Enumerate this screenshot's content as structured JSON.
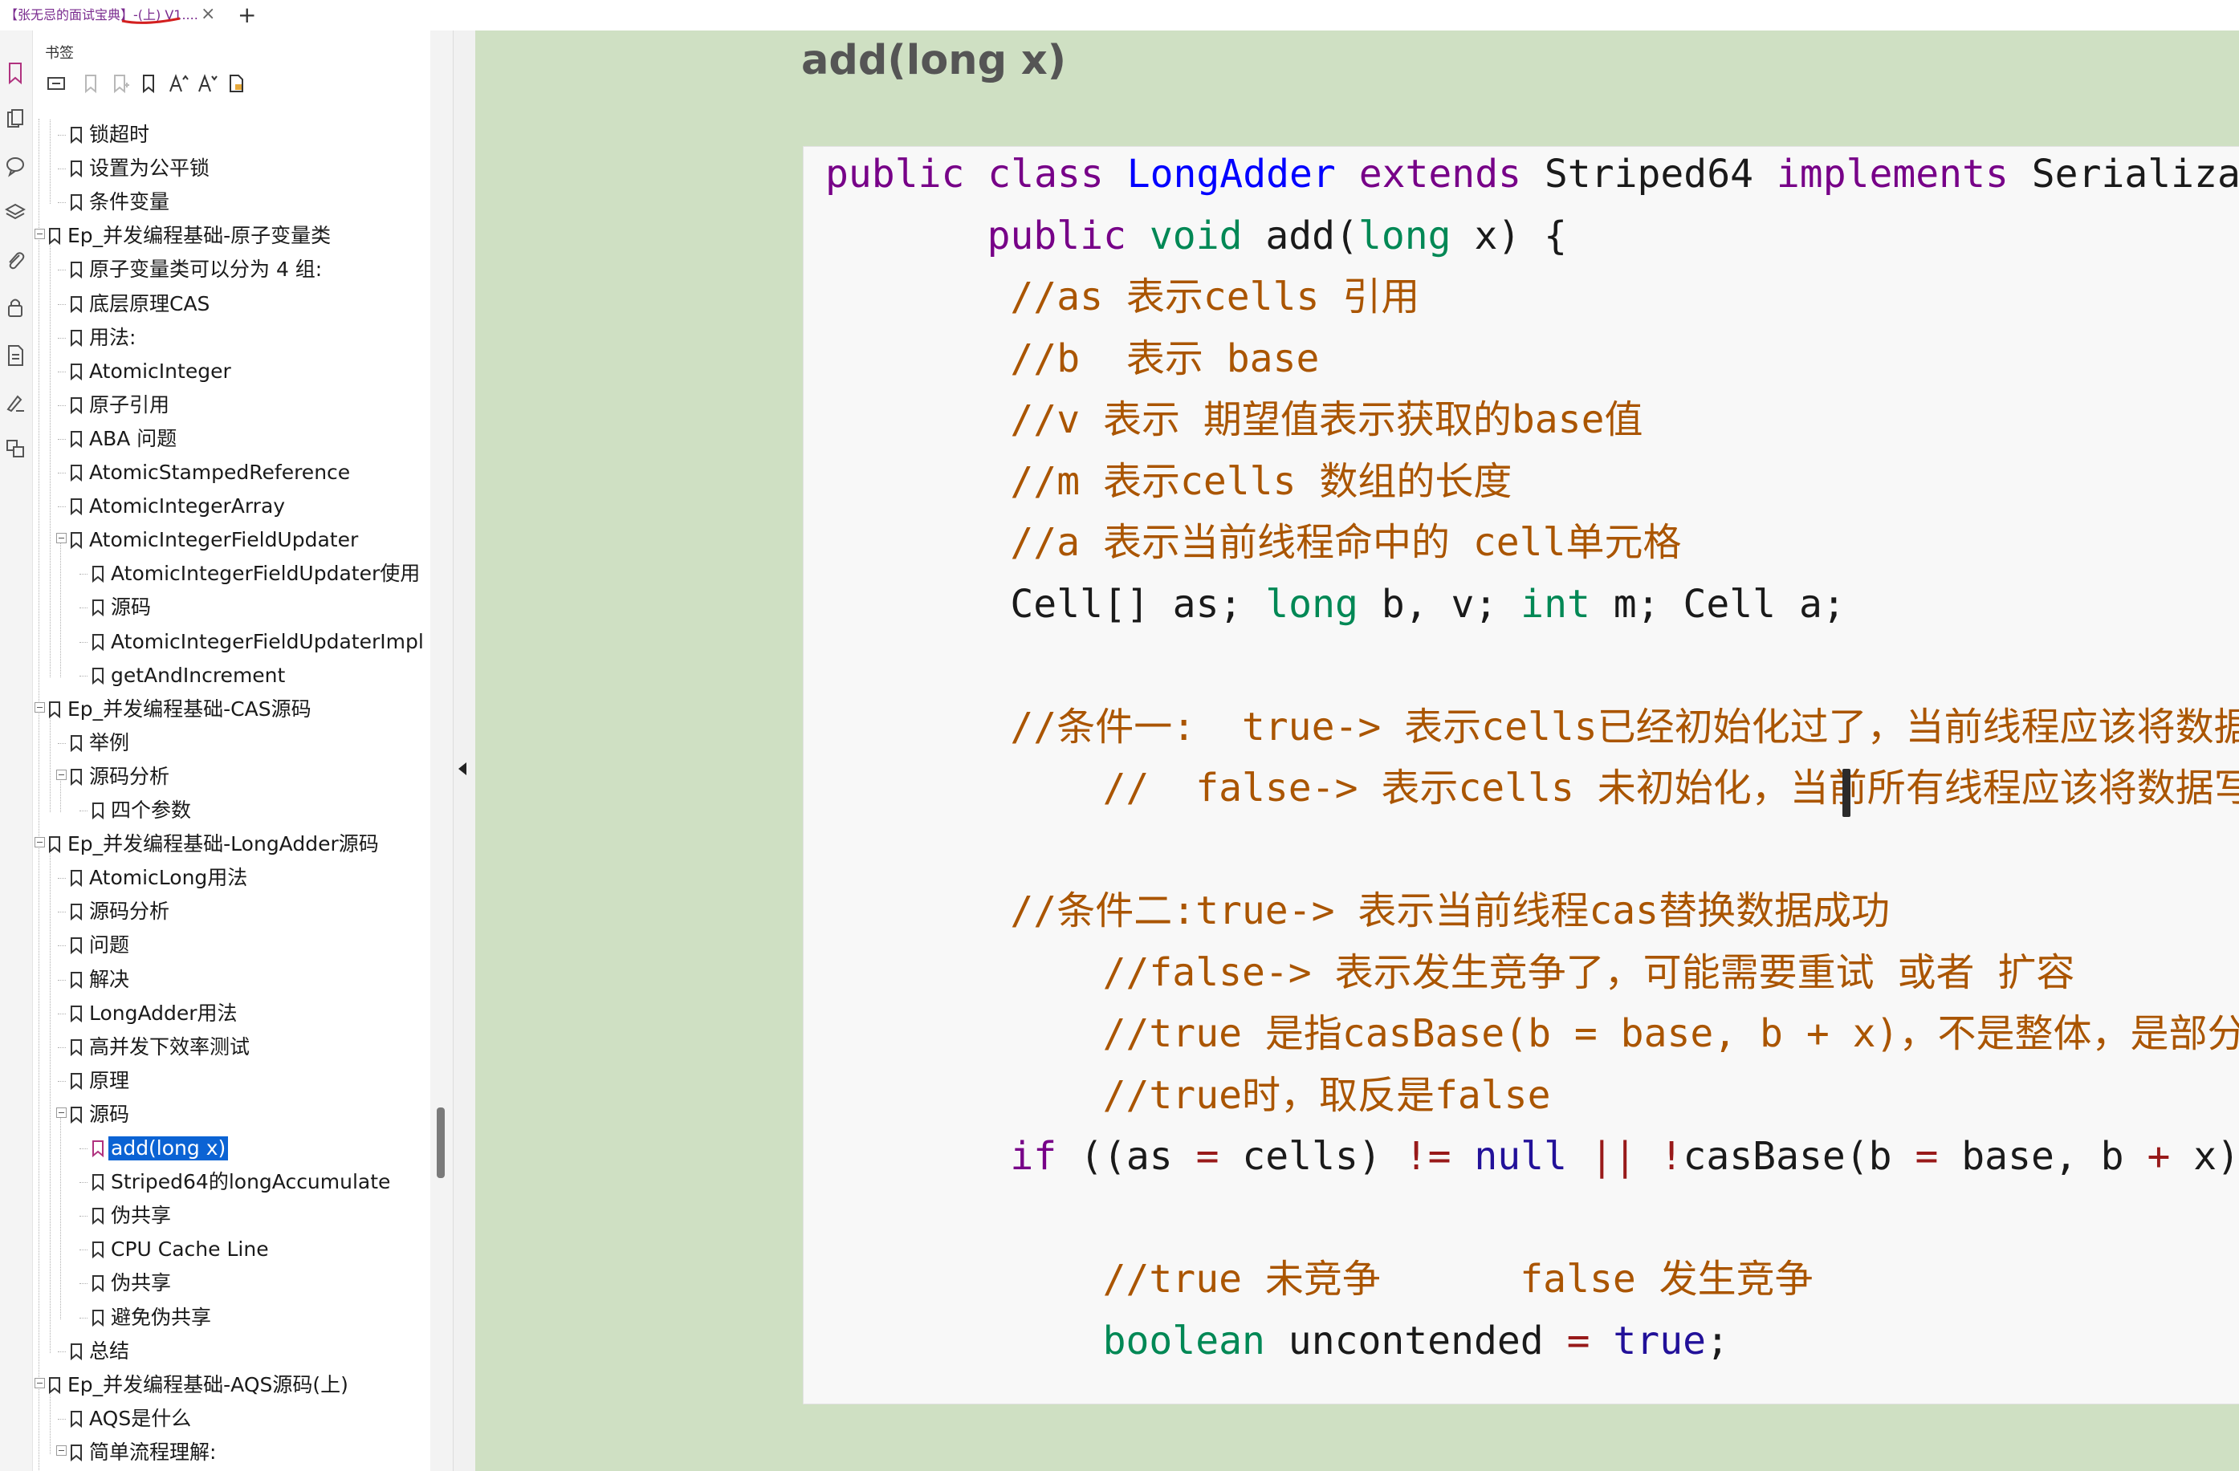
{
  "tab": {
    "title": "【张无忌的面试宝典】-(上)  V1...."
  },
  "panel": {
    "title": "书签"
  },
  "bookmarks": [
    {
      "label": "锁超时",
      "level": 2
    },
    {
      "label": "设置为公平锁",
      "level": 2
    },
    {
      "label": "条件变量",
      "level": 2
    },
    {
      "label": "Ep_并发编程基础-原子变量类",
      "level": 1,
      "expanded": true
    },
    {
      "label": "原子变量类可以分为 4 组:",
      "level": 2
    },
    {
      "label": "底层原理CAS",
      "level": 2
    },
    {
      "label": "用法:",
      "level": 2
    },
    {
      "label": "AtomicInteger",
      "level": 2
    },
    {
      "label": "原子引用",
      "level": 2
    },
    {
      "label": "ABA 问题",
      "level": 2
    },
    {
      "label": "AtomicStampedReference",
      "level": 2
    },
    {
      "label": "AtomicIntegerArray",
      "level": 2
    },
    {
      "label": "AtomicIntegerFieldUpdater",
      "level": 2,
      "expanded": true
    },
    {
      "label": "AtomicIntegerFieldUpdater使用",
      "level": 3
    },
    {
      "label": "源码",
      "level": 3
    },
    {
      "label": "AtomicIntegerFieldUpdaterImpl",
      "level": 3
    },
    {
      "label": "getAndIncrement",
      "level": 3
    },
    {
      "label": "Ep_并发编程基础-CAS源码",
      "level": 1,
      "expanded": true
    },
    {
      "label": "举例",
      "level": 2
    },
    {
      "label": "源码分析",
      "level": 2,
      "expanded": true
    },
    {
      "label": "四个参数",
      "level": 3
    },
    {
      "label": "Ep_并发编程基础-LongAdder源码",
      "level": 1,
      "expanded": true
    },
    {
      "label": "AtomicLong用法",
      "level": 2
    },
    {
      "label": "源码分析",
      "level": 2
    },
    {
      "label": "问题",
      "level": 2
    },
    {
      "label": "解决",
      "level": 2
    },
    {
      "label": "LongAdder用法",
      "level": 2
    },
    {
      "label": "高并发下效率测试",
      "level": 2
    },
    {
      "label": "原理",
      "level": 2
    },
    {
      "label": "源码",
      "level": 2,
      "expanded": true
    },
    {
      "label": "add(long x)",
      "level": 3,
      "selected": true
    },
    {
      "label": "Striped64的longAccumulate",
      "level": 3
    },
    {
      "label": "伪共享",
      "level": 3
    },
    {
      "label": "CPU Cache Line",
      "level": 3
    },
    {
      "label": "伪共享",
      "level": 3
    },
    {
      "label": "避免伪共享",
      "level": 3
    },
    {
      "label": "总结",
      "level": 2
    },
    {
      "label": "Ep_并发编程基础-AQS源码(上)",
      "level": 1,
      "expanded": true
    },
    {
      "label": "AQS是什么",
      "level": 2
    },
    {
      "label": "简单流程理解:",
      "level": 2,
      "expanded": true
    }
  ],
  "document": {
    "heading": "add(long x)",
    "code_lines": [
      {
        "indent": 0,
        "tokens": [
          [
            "kw",
            "public"
          ],
          [
            "txt",
            " "
          ],
          [
            "kw",
            "class"
          ],
          [
            "txt",
            " "
          ],
          [
            "def",
            "LongAdder"
          ],
          [
            "txt",
            " "
          ],
          [
            "kw",
            "extends"
          ],
          [
            "txt",
            " Striped64 "
          ],
          [
            "kw",
            "implements"
          ],
          [
            "txt",
            " Serializable {"
          ]
        ]
      },
      {
        "indent": 7,
        "tokens": [
          [
            "kw",
            "public"
          ],
          [
            "txt",
            " "
          ],
          [
            "typ",
            "void"
          ],
          [
            "txt",
            " add("
          ],
          [
            "typ",
            "long"
          ],
          [
            "txt",
            " x) {"
          ]
        ]
      },
      {
        "indent": 8,
        "tokens": [
          [
            "cm",
            "//as 表示cells 引用"
          ]
        ]
      },
      {
        "indent": 8,
        "tokens": [
          [
            "cm",
            "//b  表示 base"
          ]
        ]
      },
      {
        "indent": 8,
        "tokens": [
          [
            "cm",
            "//v 表示 期望值表示获取的base值"
          ]
        ]
      },
      {
        "indent": 8,
        "tokens": [
          [
            "cm",
            "//m 表示cells 数组的长度"
          ]
        ]
      },
      {
        "indent": 8,
        "tokens": [
          [
            "cm",
            "//a 表示当前线程命中的 cell单元格"
          ]
        ]
      },
      {
        "indent": 8,
        "tokens": [
          [
            "txt",
            "Cell[] as; "
          ],
          [
            "typ",
            "long"
          ],
          [
            "txt",
            " b, v; "
          ],
          [
            "typ",
            "int"
          ],
          [
            "txt",
            " m; Cell a;"
          ]
        ]
      },
      {
        "indent": 8,
        "tokens": []
      },
      {
        "indent": 8,
        "tokens": [
          [
            "cm",
            "//条件一:  true-> 表示cells已经初始化过了，当前线程应该将数据写入到对应的cell中"
          ]
        ]
      },
      {
        "indent": 12,
        "tokens": [
          [
            "cm",
            "//  false-> 表示cells 未初始化，当前所有线程应该将数据写到base中"
          ]
        ]
      },
      {
        "indent": 8,
        "tokens": []
      },
      {
        "indent": 8,
        "tokens": [
          [
            "cm",
            "//条件二:true-> 表示当前线程cas替换数据成功"
          ]
        ]
      },
      {
        "indent": 12,
        "tokens": [
          [
            "cm",
            "//false-> 表示发生竞争了，可能需要重试 或者 扩容"
          ]
        ]
      },
      {
        "indent": 12,
        "tokens": [
          [
            "cm",
            "//true 是指casBase(b = base, b + x)，不是整体，是部分"
          ]
        ]
      },
      {
        "indent": 12,
        "tokens": [
          [
            "cm",
            "//true时，取反是false"
          ]
        ]
      },
      {
        "indent": 8,
        "tokens": [
          [
            "kw",
            "if"
          ],
          [
            "txt",
            " ((as "
          ],
          [
            "op",
            "="
          ],
          [
            "txt",
            " cells) "
          ],
          [
            "op",
            "!="
          ],
          [
            "txt",
            " "
          ],
          [
            "atom",
            "null"
          ],
          [
            "txt",
            " "
          ],
          [
            "op",
            "||"
          ],
          [
            "txt",
            " "
          ],
          [
            "op",
            "!"
          ],
          [
            "txt",
            "casBase(b "
          ],
          [
            "op",
            "="
          ],
          [
            "txt",
            " base, b "
          ],
          [
            "op",
            "+"
          ],
          [
            "txt",
            " x)) {"
          ]
        ]
      },
      {
        "indent": 8,
        "tokens": []
      },
      {
        "indent": 12,
        "tokens": [
          [
            "cm",
            "//true 未竞争      false 发生竞争"
          ]
        ]
      },
      {
        "indent": 12,
        "tokens": [
          [
            "typ",
            "boolean"
          ],
          [
            "txt",
            " uncontended "
          ],
          [
            "op",
            "="
          ],
          [
            "txt",
            " "
          ],
          [
            "atom",
            "true"
          ],
          [
            "txt",
            ";"
          ]
        ]
      }
    ]
  }
}
